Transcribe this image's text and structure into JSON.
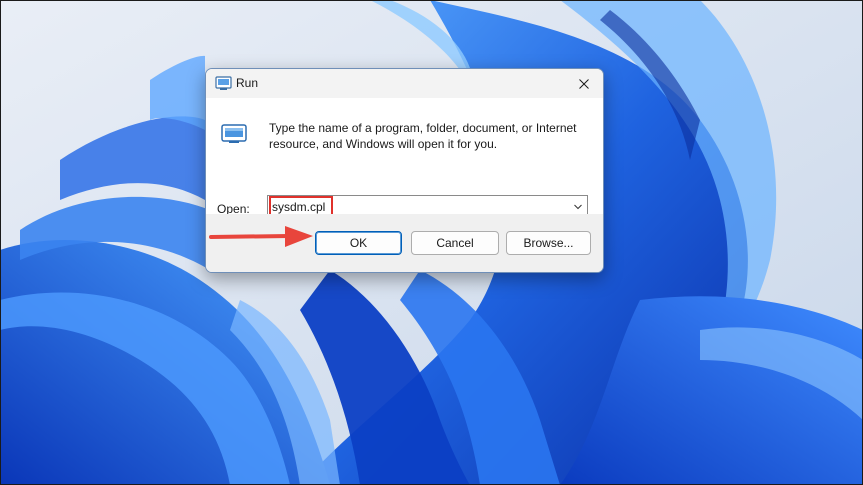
{
  "colors": {
    "accent": "#005fb8",
    "highlight": "#e0312b",
    "arrow": "#e8453c",
    "wallpaper_blue": "#1f63e0"
  },
  "dialog": {
    "title": "Run",
    "title_icon": "run-icon",
    "close_icon": "close-icon",
    "program_icon": "run-program-icon",
    "description": "Type the name of a program, folder, document, or Internet resource, and Windows will open it for you.",
    "open_label_accel": "O",
    "open_label_rest": "pen:",
    "open_value": "sysdm.cpl",
    "dropdown_icon": "chevron-down-icon",
    "buttons": {
      "ok": "OK",
      "cancel": "Cancel",
      "browse": "Browse..."
    }
  },
  "annotations": {
    "highlight": "red-highlight-box",
    "arrow": "red-arrow-pointing-to-ok"
  }
}
